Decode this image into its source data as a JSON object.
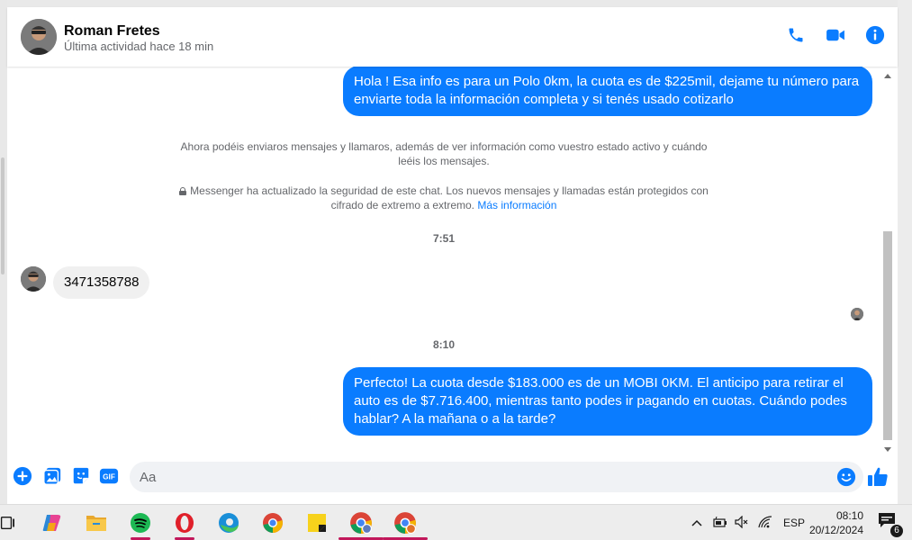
{
  "header": {
    "name": "Roman Fretes",
    "status": "Última actividad hace 18 min"
  },
  "messages": {
    "out_1": "Hola ! Esa info es para un Polo 0km, la cuota es de $225mil, dejame tu número para enviarte toda la información completa y si tenés usado cotizarlo",
    "system_1": "Ahora podéis enviaros mensajes y llamaros, además de ver información como vuestro estado activo y cuándo leéis los mensajes.",
    "system_2": "Messenger ha actualizado la seguridad de este chat. Los nuevos mensajes y llamadas están protegidos con cifrado de extremo a extremo.",
    "system_2_link": "Más información",
    "time_1": "7:51",
    "in_1": "3471358788",
    "time_2": "8:10",
    "out_2": "Perfecto! La cuota desde $183.000 es de un MOBI 0KM. El anticipo para retirar el auto es de $7.716.400, mientras tanto podes ir pagando en cuotas. Cuándo podes hablar? A la mañana o a la tarde?"
  },
  "composer": {
    "placeholder": "Aa",
    "gif_label": "GIF"
  },
  "taskbar": {
    "language": "ESP",
    "time": "08:10",
    "date": "20/12/2024",
    "notification_count": "6"
  },
  "colors": {
    "accent": "#0a7cff",
    "bubble_in": "#f0f0f0"
  }
}
